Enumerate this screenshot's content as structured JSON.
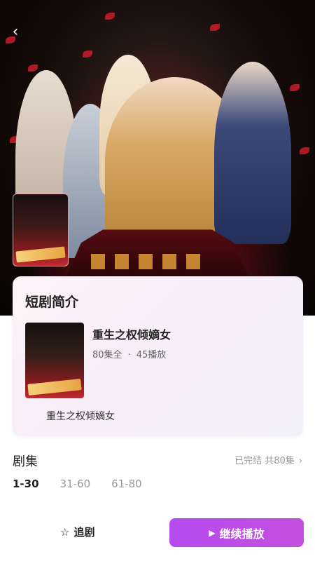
{
  "header": {
    "back_icon": "chevron-left-icon"
  },
  "intro": {
    "title": "短剧简介",
    "drama_name": "重生之权倾嫡女",
    "episodes_total": "80集全",
    "plays": "45播放",
    "description": "重生之权倾嫡女"
  },
  "episodes": {
    "label": "剧集",
    "status": "已完结 共80集",
    "ranges": [
      "1-30",
      "31-60",
      "61-80"
    ],
    "active_range": "1-30"
  },
  "actions": {
    "follow_label": "追剧",
    "follow_icon": "star-outline-icon",
    "play_label": "继续播放",
    "play_icon": "play-icon"
  },
  "colors": {
    "accent_start": "#b54bf0",
    "accent_end": "#c44fdd"
  }
}
